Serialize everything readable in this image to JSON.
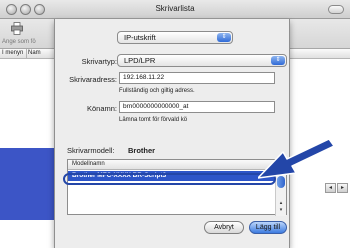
{
  "window": {
    "title": "Skrivarlista"
  },
  "toolbar": {
    "add_label": "Ange som fö"
  },
  "list_headers": {
    "col1": "I menyn",
    "col2": "Nam"
  },
  "sheet": {
    "protocol_popup": "IP-utskrift",
    "printer_type_label": "Skrivartyp:",
    "printer_type_value": "LPD/LPR",
    "address_label": "Skrivaradress:",
    "address_value": "192.168.11.22",
    "address_hint": "Fullständig och giltig adress.",
    "queue_label": "Könamn:",
    "queue_value": "brn0000000000000_at",
    "queue_hint": "Lämna tomt för förvald kö",
    "model_label": "Skrivarmodell:",
    "model_value": "Brother",
    "model_list_header": "Modellnamn",
    "model_list_items": [
      "Brother MFC-XXXX BR-Script3"
    ],
    "cancel_label": "Avbryt",
    "add_label": "Lägg till"
  },
  "colors": {
    "selection": "#2d55c8",
    "callout_arrow": "#2346a8",
    "background_blue": "#3c55c6"
  },
  "icons": [
    "printer-icon",
    "chevron-updown-icon",
    "callout-arrow-icon"
  ]
}
